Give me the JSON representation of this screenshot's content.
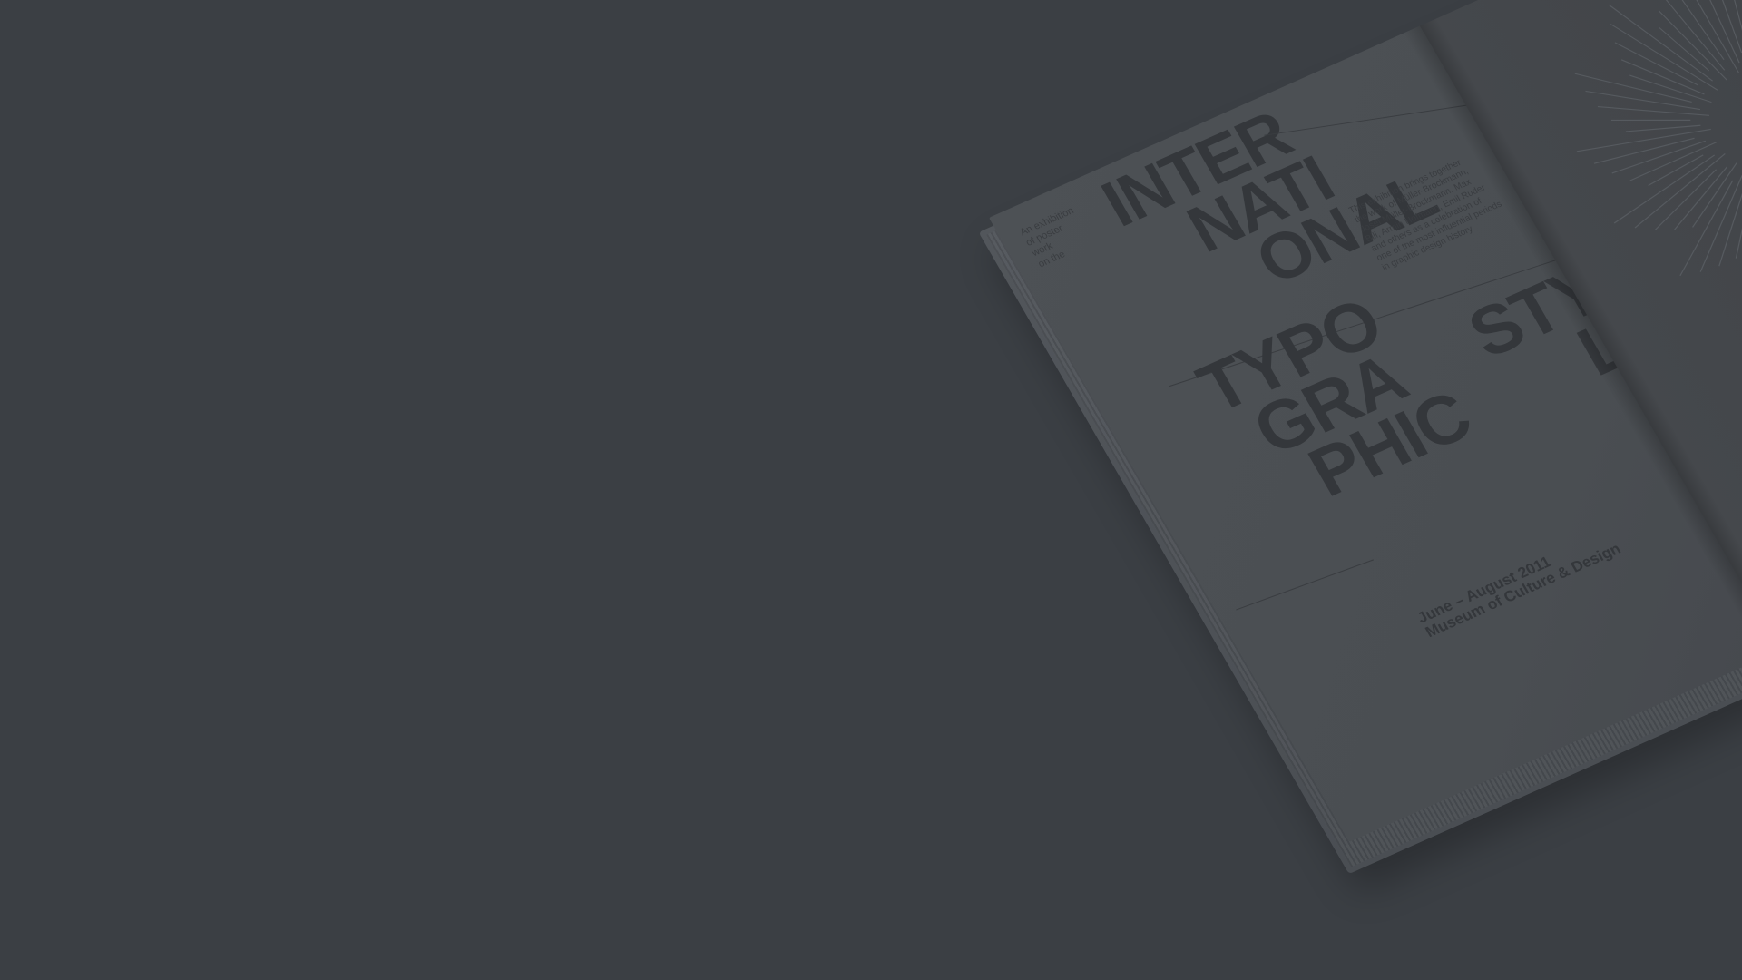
{
  "scene": {
    "background_color": "#3b3f44",
    "book_page_color": "#4b4f53",
    "ink_color": "#34373b"
  },
  "cover": {
    "title_lines": [
      "INTER",
      "NATI",
      "ONAL"
    ],
    "typo_lines": [
      "TYPO",
      "GRA",
      "PHIC"
    ],
    "style_lines": [
      "STY",
      "LE"
    ],
    "tagline_lines": [
      "An exhibition",
      "of poster",
      "work",
      "on the"
    ],
    "description": "This exhibition brings together the work of Müller-Brockmann, Josef Müller-Brockmann, Max Bill, Armin Hofmann, Emil Ruder and others as a celebration of one of the most influential periods in graphic design history",
    "date_line": "June – August 2011",
    "venue_line": "Museum of Culture & Design"
  }
}
